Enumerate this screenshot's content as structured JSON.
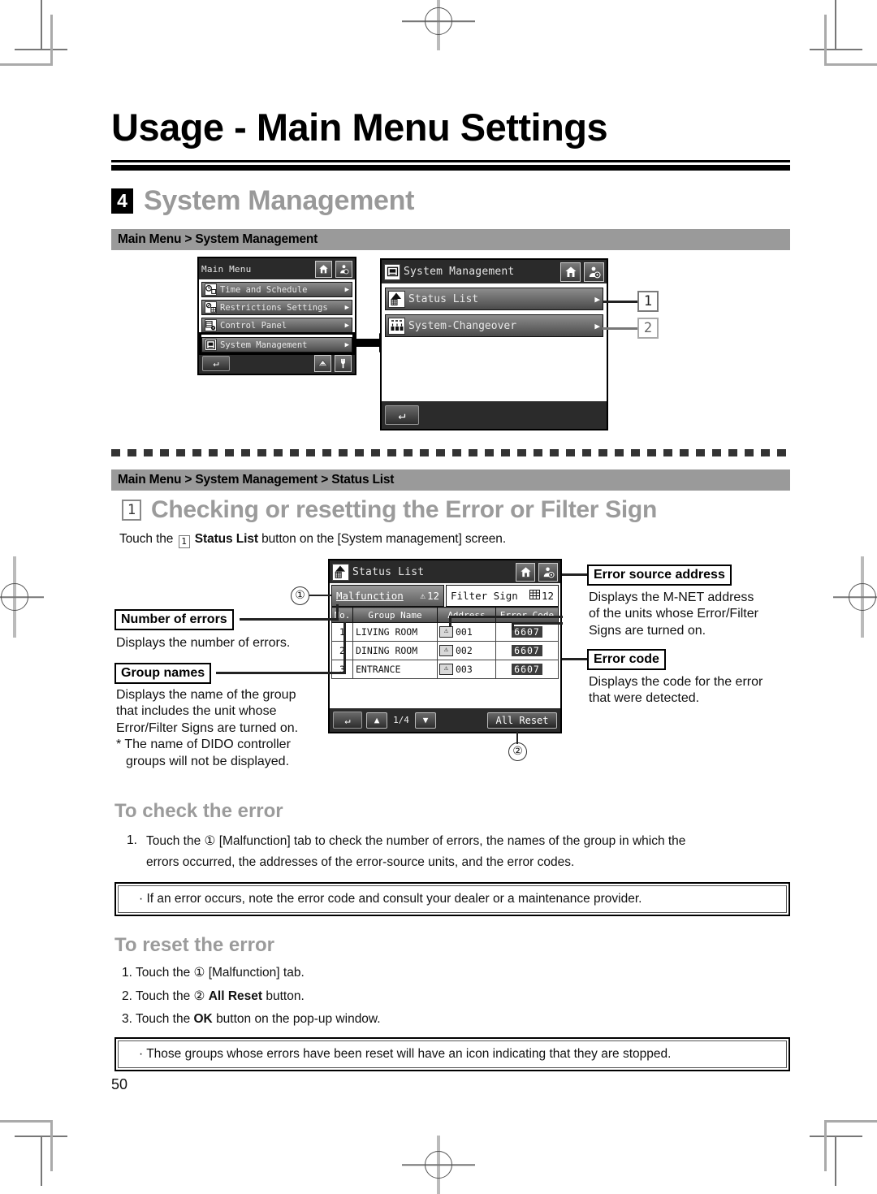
{
  "page": {
    "title": "Usage - Main Menu Settings",
    "page_number": "50"
  },
  "section": {
    "number": "4",
    "title": "System Management",
    "breadcrumb": "Main Menu > System Management"
  },
  "screens": {
    "main_menu": {
      "title": "Main Menu",
      "header_icons": [
        "home-icon",
        "user-gear-icon"
      ],
      "items": [
        {
          "label": "Time and Schedule",
          "icon": "clock-schedule-icon",
          "chevron": "▶"
        },
        {
          "label": "Restrictions Settings",
          "icon": "restrictions-icon",
          "chevron": "▶"
        },
        {
          "label": "Control Panel",
          "icon": "control-panel-icon",
          "chevron": "▶"
        },
        {
          "label": "System Management",
          "icon": "system-management-icon",
          "chevron": "▶"
        }
      ],
      "footer": {
        "back": "↵",
        "icon_left": "network-icon",
        "icon_right": "service-icon"
      }
    },
    "system_management": {
      "title": "System Management",
      "header_icons": [
        "home-icon",
        "user-gear-icon"
      ],
      "items": [
        {
          "label": "Status List",
          "icon": "status-list-icon",
          "chevron": "▶",
          "tag": "1"
        },
        {
          "label": "System-Changeover",
          "icon": "changeover-icon",
          "chevron": "▶",
          "tag": "2"
        }
      ],
      "footer": {
        "back": "↵"
      }
    },
    "status_list": {
      "title": "Status List",
      "header_icons": [
        "home-icon",
        "user-gear-icon"
      ],
      "tabs": [
        {
          "label": "Malfunction",
          "count": "12",
          "icon": "warning-triangle-icon",
          "state": "active"
        },
        {
          "label": "Filter Sign",
          "count": "12",
          "icon": "filter-grid-icon",
          "state": "inactive"
        }
      ],
      "columns": [
        "No.",
        "Group Name",
        "Address",
        "Error Code"
      ],
      "rows": [
        {
          "no": "1",
          "group_name": "LIVING ROOM",
          "address": "001",
          "error_code": "6607"
        },
        {
          "no": "2",
          "group_name": "DINING ROOM",
          "address": "002",
          "error_code": "6607"
        },
        {
          "no": "3",
          "group_name": "ENTRANCE",
          "address": "003",
          "error_code": "6607"
        }
      ],
      "footer": {
        "back": "↵",
        "up": "▲",
        "page_indicator": "1/4",
        "down": "▼",
        "all_reset": "All Reset"
      }
    }
  },
  "callouts": {
    "tag1": "1",
    "tag2": "2",
    "circle1": "①",
    "circle2": "②"
  },
  "annotations": {
    "number_of_errors": {
      "label": "Number of errors",
      "text": "Displays the number of errors."
    },
    "group_names": {
      "label": "Group names",
      "line1": "Displays the name of the group",
      "line2": "that includes the unit whose",
      "line3": "Error/Filter Signs are turned on.",
      "line4": "* The name of DIDO controller",
      "line5": "groups will not be displayed."
    },
    "error_source_address": {
      "label": "Error source address",
      "line1": "Displays the M-NET address",
      "line2": "of the units whose Error/Filter",
      "line3": "Signs are turned on."
    },
    "error_code": {
      "label": "Error code",
      "line1": "Displays the code for the error",
      "line2": "that were detected."
    }
  },
  "subsection": {
    "number": "1",
    "breadcrumb": "Main Menu > System Management > Status List",
    "title": "Checking or resetting the Error or Filter Sign",
    "intro_pre": "Touch the",
    "intro_num": "1",
    "intro_bold": "Status List",
    "intro_post": "button on the [System management] screen."
  },
  "check_error": {
    "heading": "To check the error",
    "step_marker": "1.",
    "step_line1_a": "Touch the",
    "step_line1_circle": "①",
    "step_line1_b": "[Malfunction] tab to check the number of errors, the names of the group in which the",
    "step_line2": "errors occurred, the addresses of the error-source units, and the error codes.",
    "note": "· If an error occurs, note the error code and consult your dealer or a maintenance provider."
  },
  "reset_error": {
    "heading": "To reset the error",
    "steps": [
      {
        "marker": "1.",
        "pre": "Touch the",
        "circle": "①",
        "post": "[Malfunction] tab.",
        "bold": ""
      },
      {
        "marker": "2.",
        "pre": "Touch the",
        "circle": "②",
        "bold": "All Reset",
        "post": "button."
      },
      {
        "marker": "3.",
        "pre": "Touch the",
        "circle": "",
        "bold": "OK",
        "post": "button on the pop-up window."
      }
    ],
    "note": "· Those groups whose errors have been reset will have an icon indicating that they are stopped."
  },
  "colors": {
    "breadcrumb_bg": "#9a9a9a",
    "heading_grey": "#9b9b9b",
    "lcd_dark": "#2a2a2a",
    "crop_mark": "#777777"
  }
}
